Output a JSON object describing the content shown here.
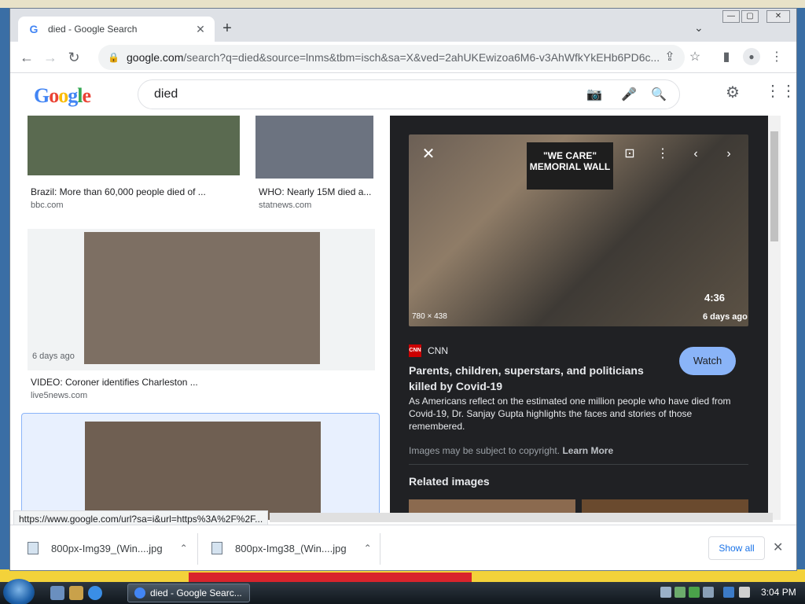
{
  "browser": {
    "tab_title": "died - Google Search",
    "url_host": "google.com",
    "url_path": "/search?q=died&source=lnms&tbm=isch&sa=X&ved=2ahUKEwizoa6M6-v3AhWfkYkEHb6PD6c..."
  },
  "google": {
    "logo_text": "Google",
    "query": "died"
  },
  "results": [
    {
      "caption": "Brazil: More than 60,000 people died of ...",
      "source": "bbc.com"
    },
    {
      "caption": "WHO: Nearly 15M died a...",
      "source": "statnews.com"
    },
    {
      "caption": "VIDEO: Coroner identifies Charleston ...",
      "source": "live5news.com",
      "ago": "6 days ago"
    }
  ],
  "panel": {
    "image_size": "780 × 438",
    "duration": "4:36",
    "ago": "6 days ago",
    "wall_sign": "\"WE CARE\" MEMORIAL WALL",
    "source_name": "CNN",
    "source_logo": "CNN",
    "headline": "Parents, children, superstars, and politicians killed by Covid-19",
    "watch_label": "Watch",
    "description": "As Americans reflect on the estimated one million people who have died from Covid-19, Dr. Sanjay Gupta highlights the faces and stories of those remembered.",
    "copyright_text": "Images may be subject to copyright.",
    "learn_more": "Learn More",
    "related_title": "Related images"
  },
  "status_url": "https://www.google.com/url?sa=i&url=https%3A%2F%2F...",
  "downloads": [
    {
      "name": "800px-Img39_(Win....jpg"
    },
    {
      "name": "800px-Img38_(Win....jpg"
    }
  ],
  "show_all_label": "Show all",
  "taskbar": {
    "task_label": "died - Google Searc...",
    "clock": "3:04 PM"
  }
}
